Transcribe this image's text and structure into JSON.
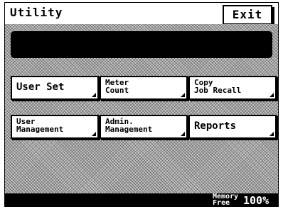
{
  "header": {
    "title": "Utility",
    "exit_label": "Exit"
  },
  "menu": {
    "user_set": "User Set",
    "meter_count": "Meter\nCount",
    "copy_job_recall": "Copy\nJob Recall",
    "user_management": "User\nManagement",
    "admin_management": "Admin.\nManagement",
    "reports": "Reports"
  },
  "status": {
    "memory_label": "Memory\nFree",
    "memory_value": "100%"
  }
}
